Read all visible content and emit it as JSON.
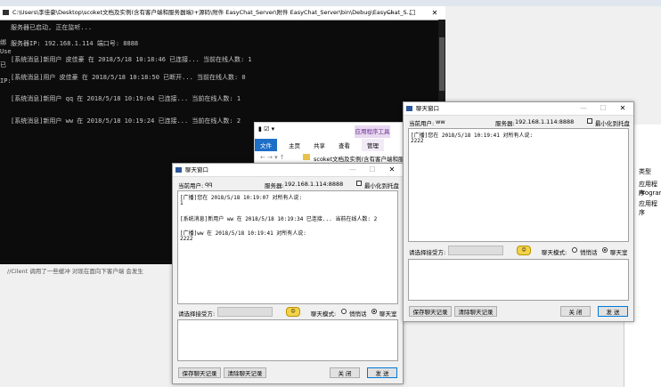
{
  "console": {
    "title": "C:\\Users\\李佳豪\\Desktop\\scoket文档及实例(含有客户端和服务器端)+源码\\附件 EasyChat_Server\\附件 EasyChat_Server\\bin\\Debug\\EasyChat_S...",
    "lines": [
      "服务器已启动, 正在监听...",
      "服务器IP: 192.168.1.114 端口号: 8888",
      "[系统消息]新用户 皮佳豪 在 2018/5/18 10:18:46 已连接... 当前在线人数: 1",
      "[系统消息]用户 皮佳豪 在 2018/5/18 10:18:50 已断开... 当前在线人数: 0",
      "[系统消息]新用户 qq 在 2018/5/18 10:19:04 已连接... 当前在线人数: 1",
      "[系统消息]新用户 ww 在 2018/5/18 10:19:24 已连接... 当前在线人数: 2"
    ],
    "side_fragments": [
      "绑",
      "Use",
      "已",
      "IP:"
    ]
  },
  "explorer": {
    "tabs": [
      "文件",
      "主页",
      "共享",
      "查看"
    ],
    "context_tab": "应用程序工具",
    "manage": "管理",
    "path": "scoket文档及实例(含有客户端和服"
  },
  "right_strip": [
    "类型",
    "应用程序",
    "Program",
    "应用程序"
  ],
  "bottom_note": "//Cilent 调用了一些缓冲 对现在面向下客户端 会发生",
  "chat_left": {
    "title": "聊天窗口",
    "current_user_label": "当前用户:",
    "current_user": "qq",
    "server_label": "服务器:",
    "server": "192.168.1.114:8888",
    "minimize_tray": "最小化到托盘",
    "messages": [
      "[广播]您在 2018/5/18 10:19:07 对所有人说:",
      "1",
      "",
      "[系统消息]新用户 ww 在 2018/5/18 10:19:34 已连接... 当前在线人数: 2",
      "",
      "[广播]ww 在 2018/5/18 10:19:41 对所有人说:",
      "2222"
    ],
    "select_recipient": "请选择接受方:",
    "chat_mode_label": "聊天模式:",
    "mode_private": "悄悄话",
    "mode_room": "聊天室",
    "save_btn": "保存聊天记录",
    "clear_btn": "清除聊天记录",
    "close_btn": "关 闭",
    "send_btn": "发 送"
  },
  "chat_right": {
    "title": "聊天窗口",
    "current_user_label": "当前用户:",
    "current_user": "ww",
    "server_label": "服务器:",
    "server": "192.168.1.114:8888",
    "minimize_tray": "最小化到托盘",
    "messages": [
      "[广播]您在 2018/5/18 10:19:41 对所有人说:",
      "2222"
    ],
    "select_recipient": "请选择接受方:",
    "chat_mode_label": "聊天模式:",
    "mode_private": "悄悄话",
    "mode_room": "聊天室",
    "save_btn": "保存聊天记录",
    "clear_btn": "清除聊天记录",
    "close_btn": "关 闭",
    "send_btn": "发 送"
  }
}
